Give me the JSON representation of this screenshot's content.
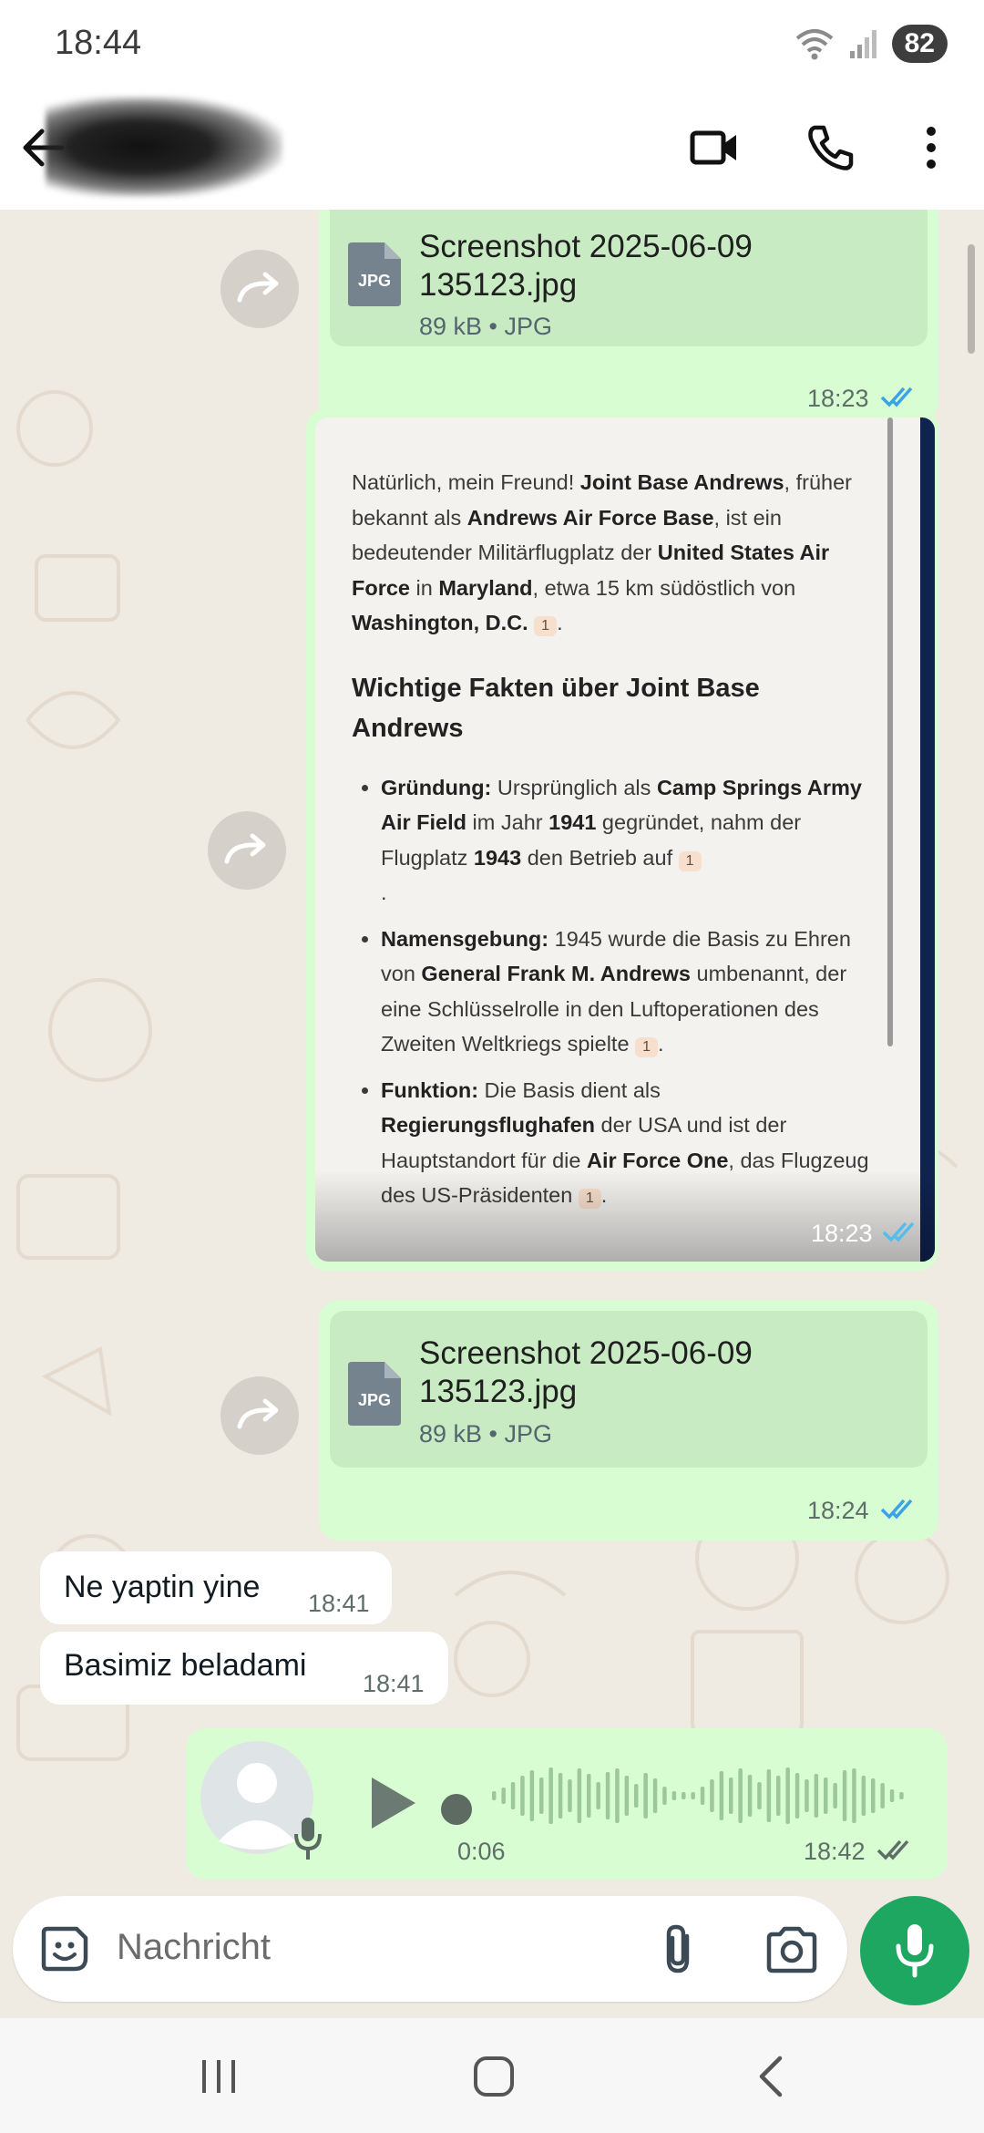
{
  "status_bar": {
    "time": "18:44",
    "battery": "82"
  },
  "header": {
    "contact_name": ""
  },
  "messages": [
    {
      "type": "file",
      "direction": "out",
      "file_name_line1": "Screenshot 2025-06-09",
      "file_name_line2": "135123.jpg",
      "meta": "89 kB • JPG",
      "icon_label": "JPG",
      "time": "18:23"
    },
    {
      "type": "image",
      "direction": "out",
      "time": "18:23"
    },
    {
      "type": "file",
      "direction": "out",
      "file_name_line1": "Screenshot 2025-06-09",
      "file_name_line2": "135123.jpg",
      "meta": "89 kB • JPG",
      "icon_label": "JPG",
      "time": "18:24"
    },
    {
      "type": "text",
      "direction": "in",
      "text": "Ne yaptin yine",
      "time": "18:41"
    },
    {
      "type": "text",
      "direction": "in",
      "text": "Basimiz beladami",
      "time": "18:41"
    },
    {
      "type": "voice",
      "direction": "out",
      "duration": "0:06",
      "time": "18:42"
    }
  ],
  "image_content": {
    "para1_a": "Natürlich, mein Freund! ",
    "para1_b": "Joint Base Andrews",
    "para1_c": ", früher bekannt als ",
    "para1_d": "Andrews Air Force Base",
    "para1_e": ", ist ein bedeutender Militärflugplatz der ",
    "para1_f": "United States Air Force",
    "para1_g": " in ",
    "para1_h": "Maryland",
    "para1_i": ", etwa 15 km südöstlich von ",
    "para1_j": "Washington, D.C.",
    "heading": "Wichtige Fakten über Joint Base Andrews",
    "b1_label": "Gründung:",
    "b1_a": " Ursprünglich als ",
    "b1_b": "Camp Springs Army Air Field",
    "b1_c": " im Jahr ",
    "b1_d": "1941",
    "b1_e": " gegründet, nahm der Flugplatz ",
    "b1_f": "1943",
    "b1_g": " den Betrieb auf",
    "b2_label": "Namensgebung:",
    "b2_a": " 1945 wurde die Basis zu Ehren von ",
    "b2_b": "General Frank M. Andrews",
    "b2_c": " umbenannt, der eine Schlüsselrolle in den Luftoperationen des Zweiten Weltkriegs spielte",
    "b3_label": "Funktion:",
    "b3_a": " Die Basis dient als ",
    "b3_b": "Regierungsflughafen",
    "b3_c": " der USA und ist der Hauptstandort für die ",
    "b3_d": "Air Force One",
    "b3_e": ", das Flugzeug des US-Präsidenten",
    "ref": "1"
  },
  "composer": {
    "placeholder": "Nachricht"
  },
  "colors": {
    "outgoing": "#d9fdd3",
    "incoming": "#ffffff",
    "accent": "#1da760",
    "read_ticks": "#53bdeb"
  }
}
